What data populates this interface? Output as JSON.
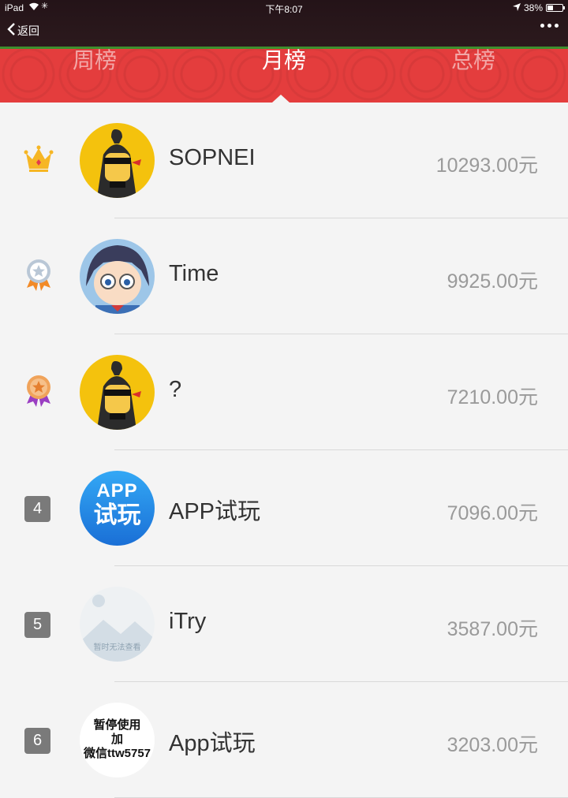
{
  "status_bar": {
    "device": "iPad",
    "time": "下午8:07",
    "battery": "38%",
    "battery_level": 0.38
  },
  "nav": {
    "back_label": "返回",
    "back_icon": "chevron-left-icon",
    "more_icon": "more-dots-icon"
  },
  "tabs": [
    {
      "label": "周榜",
      "active": false
    },
    {
      "label": "月榜",
      "active": true
    },
    {
      "label": "总榜",
      "active": false
    }
  ],
  "colors": {
    "tab_bar": "#e43d3d",
    "top_bar": "#2a181b",
    "accent_green": "#3d8f2d"
  },
  "ranking": [
    {
      "rank": "1",
      "rank_icon": "crown-icon",
      "name": "SOPNEI",
      "amount": "10293.00元",
      "avatar": "cartoon-avatar"
    },
    {
      "rank": "2",
      "rank_icon": "silver-medal-icon",
      "name": "Time",
      "amount": "9925.00元",
      "avatar": "anime-avatar"
    },
    {
      "rank": "3",
      "rank_icon": "bronze-medal-icon",
      "name": "?",
      "amount": "7210.00元",
      "avatar": "cartoon-avatar"
    },
    {
      "rank": "4",
      "name": "APP试玩",
      "amount": "7096.00元",
      "avatar": "app-logo",
      "avatar_text": [
        "APP",
        "试玩"
      ]
    },
    {
      "rank": "5",
      "name": "iTry",
      "amount": "3587.00元",
      "avatar": "image-placeholder",
      "avatar_text": [
        "暂时无法查看"
      ]
    },
    {
      "rank": "6",
      "name": "App试玩",
      "amount": "3203.00元",
      "avatar": "text-avatar",
      "avatar_text": [
        "暂停使用",
        "加",
        "微信ttw5757"
      ]
    }
  ]
}
